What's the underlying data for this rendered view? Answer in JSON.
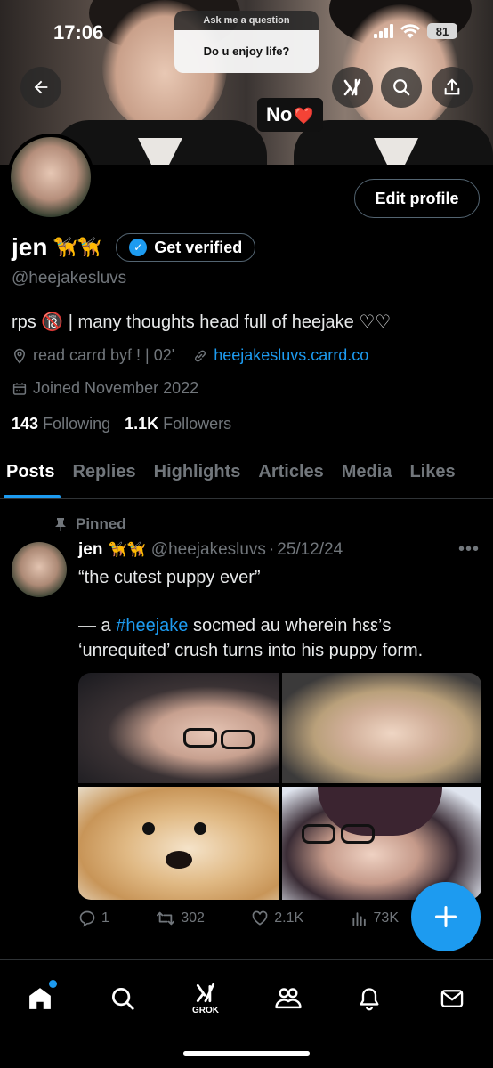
{
  "status_bar": {
    "time": "17:06",
    "battery": "81"
  },
  "banner": {
    "question_header": "Ask me a question",
    "question": "Do u enjoy life?",
    "sticker_text": "No",
    "sticker_emoji": "❤️"
  },
  "header_buttons": {
    "back_icon": "arrow-left-icon",
    "grok_icon": "grok-icon",
    "search_icon": "search-icon",
    "share_icon": "share-icon"
  },
  "profile": {
    "edit_label": "Edit profile",
    "name": "jen",
    "name_emojis": "🦮🦮",
    "get_verified_label": "Get verified",
    "handle": "@heejakesluvs",
    "bio": "rps 🔞 | many thoughts head full of heejake ♡♡",
    "location": "read carrd byf ! | 02'",
    "website": "heejakesluvs.carrd.co",
    "joined": "Joined November 2022",
    "following_count": "143",
    "following_label": "Following",
    "followers_count": "1.1K",
    "followers_label": "Followers"
  },
  "tabs": [
    "Posts",
    "Replies",
    "Highlights",
    "Articles",
    "Media",
    "Likes"
  ],
  "post": {
    "pinned_label": "Pinned",
    "name": "jen",
    "name_emojis": "🦮🦮",
    "handle": "@heejakesluvs",
    "separator": "·",
    "date": "25/12/24",
    "line1": "“the cutest puppy ever”",
    "line2_prefix": "— a ",
    "hashtag": "#heejake",
    "line2_suffix": " socmed au wherein hεε’s ‘unrequited’ crush turns into his puppy form.",
    "replies": "1",
    "reposts": "302",
    "likes": "2.1K",
    "views": "73K"
  },
  "nav": {
    "grok_label": "GROK"
  },
  "colors": {
    "accent": "#1d9bf0",
    "muted": "#71767b",
    "background": "#000000"
  }
}
